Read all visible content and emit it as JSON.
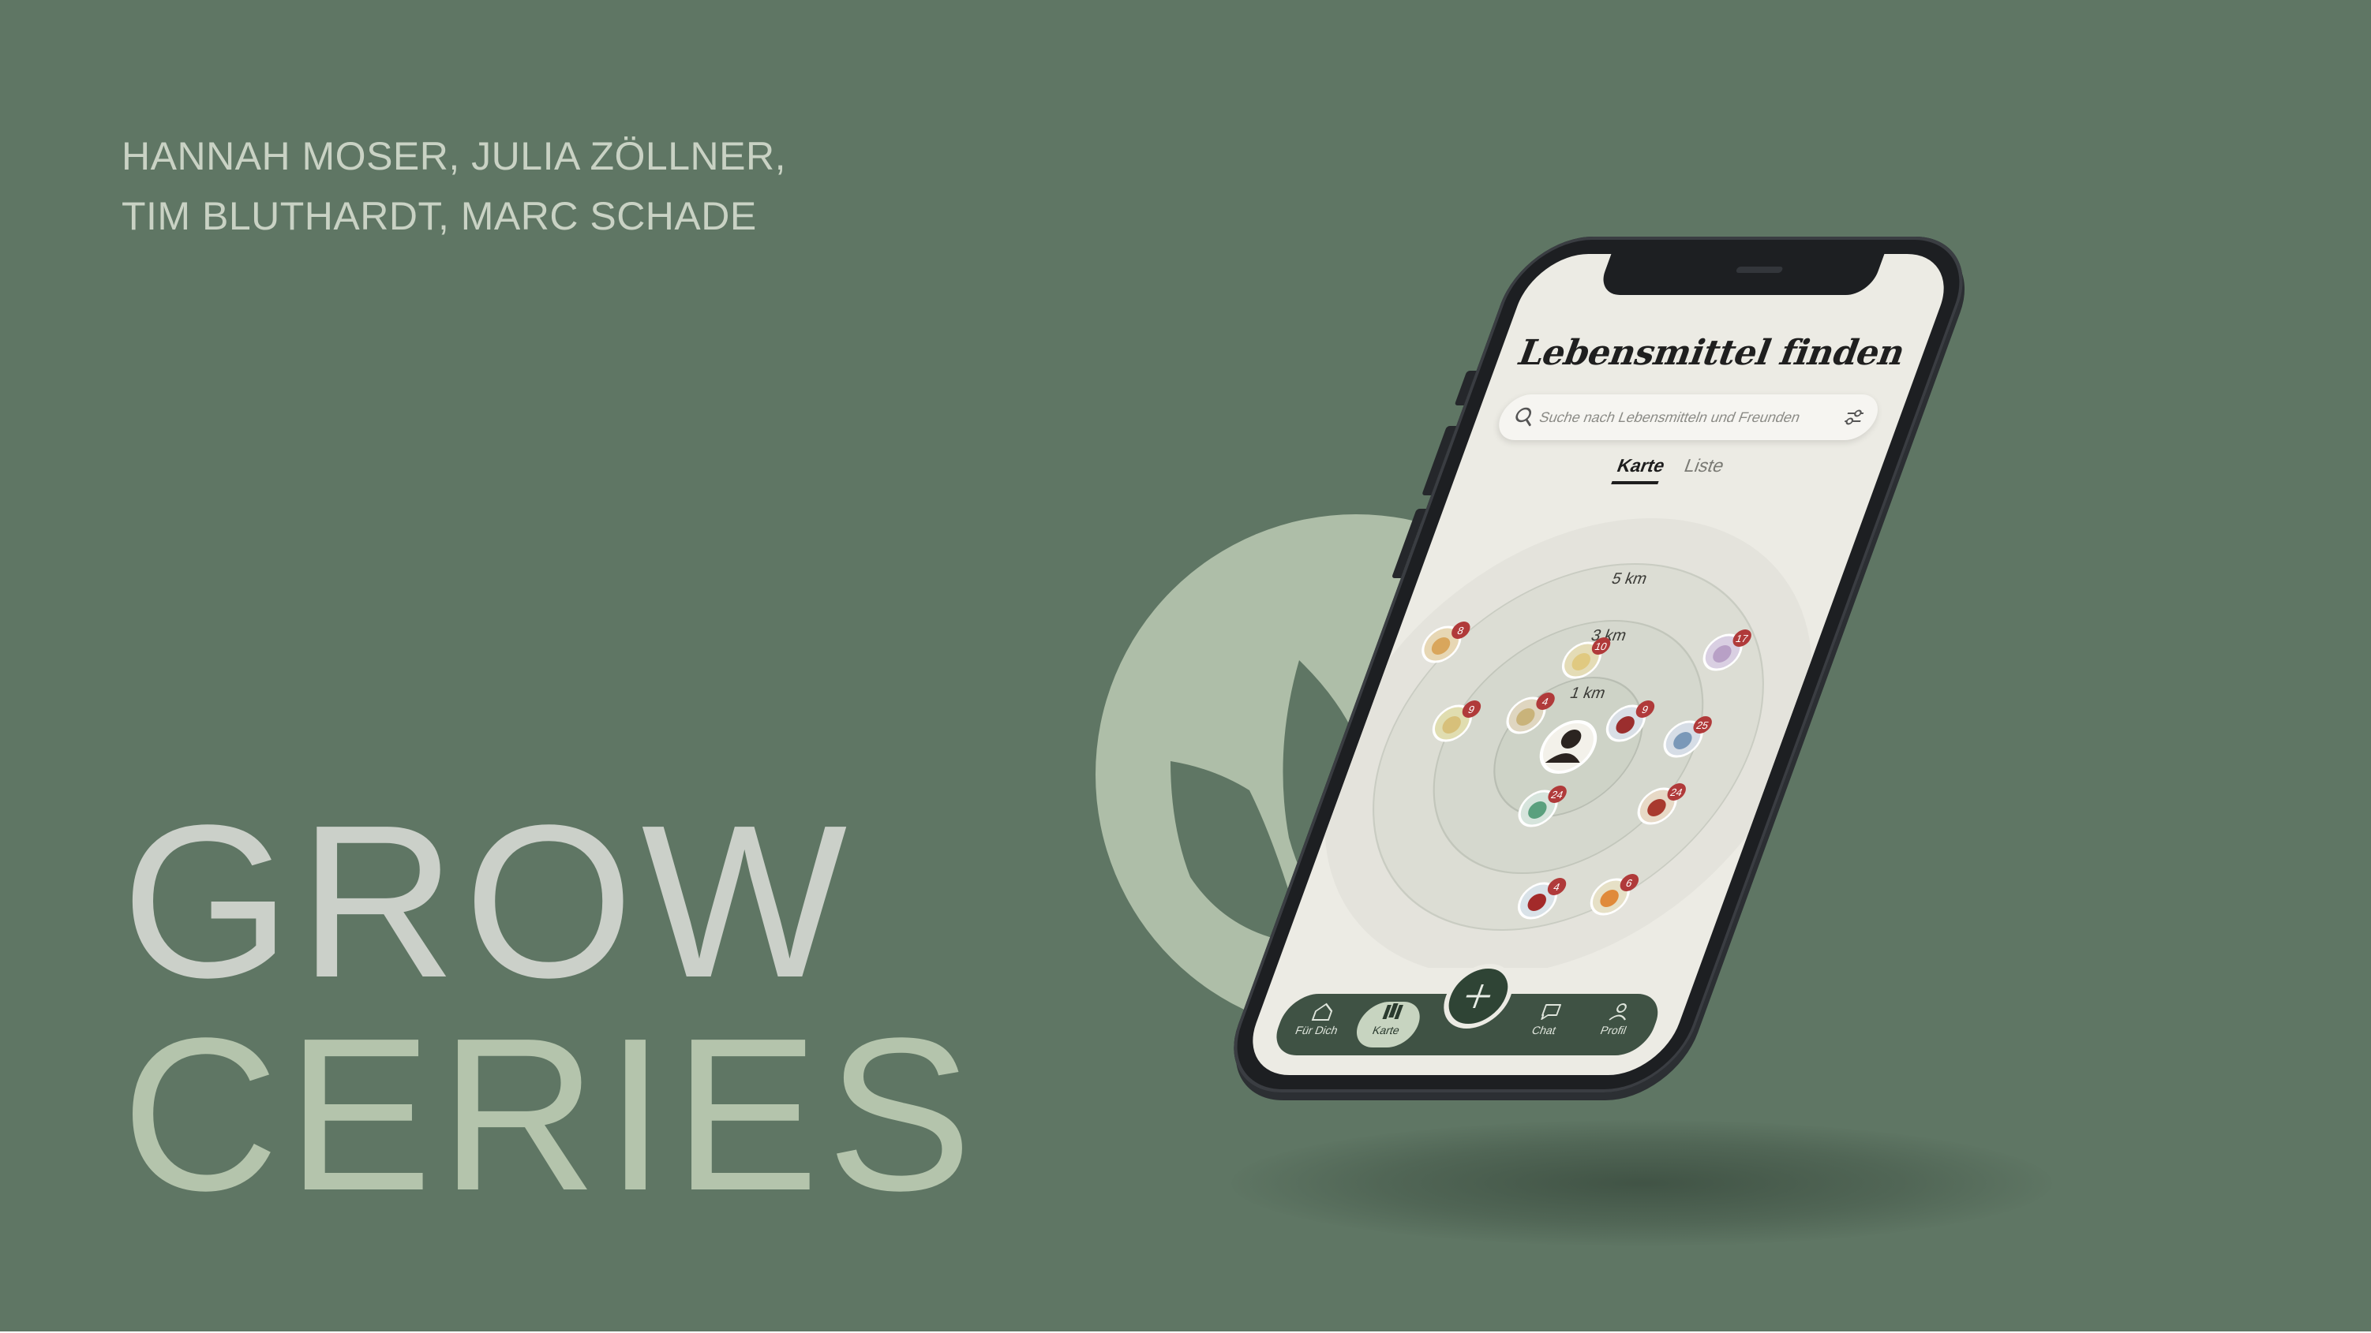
{
  "slide": {
    "authors": [
      "HANNAH MOSER, JULIA ZÖLLNER,",
      "TIM BLUTHARDT, MARC SCHADE"
    ],
    "title_line1": "GROW",
    "title_line2": "CERIES",
    "colors": {
      "background": "#5f7664",
      "logo_circle": "#aebea8",
      "title1": "#cbd0c9",
      "title2": "#b4c4ac"
    }
  },
  "phone": {
    "app_title": "Lebensmittel finden",
    "search_placeholder": "Suche nach Lebensmitteln und Freunden",
    "tabs": [
      {
        "label": "Karte",
        "active": true
      },
      {
        "label": "Liste",
        "active": false
      }
    ],
    "radar": {
      "rings": [
        "1 km",
        "3 km",
        "5 km"
      ],
      "badges": [
        "8",
        "9",
        "4",
        "10",
        "9",
        "17",
        "25",
        "24",
        "24",
        "4",
        "6"
      ]
    },
    "nav": [
      {
        "label": "Für Dich",
        "icon": "home-icon"
      },
      {
        "label": "Karte",
        "icon": "map-icon",
        "active": true
      },
      {
        "label": "",
        "icon": "plus-icon"
      },
      {
        "label": "Chat",
        "icon": "chat-icon"
      },
      {
        "label": "Profil",
        "icon": "profile-icon"
      }
    ]
  }
}
